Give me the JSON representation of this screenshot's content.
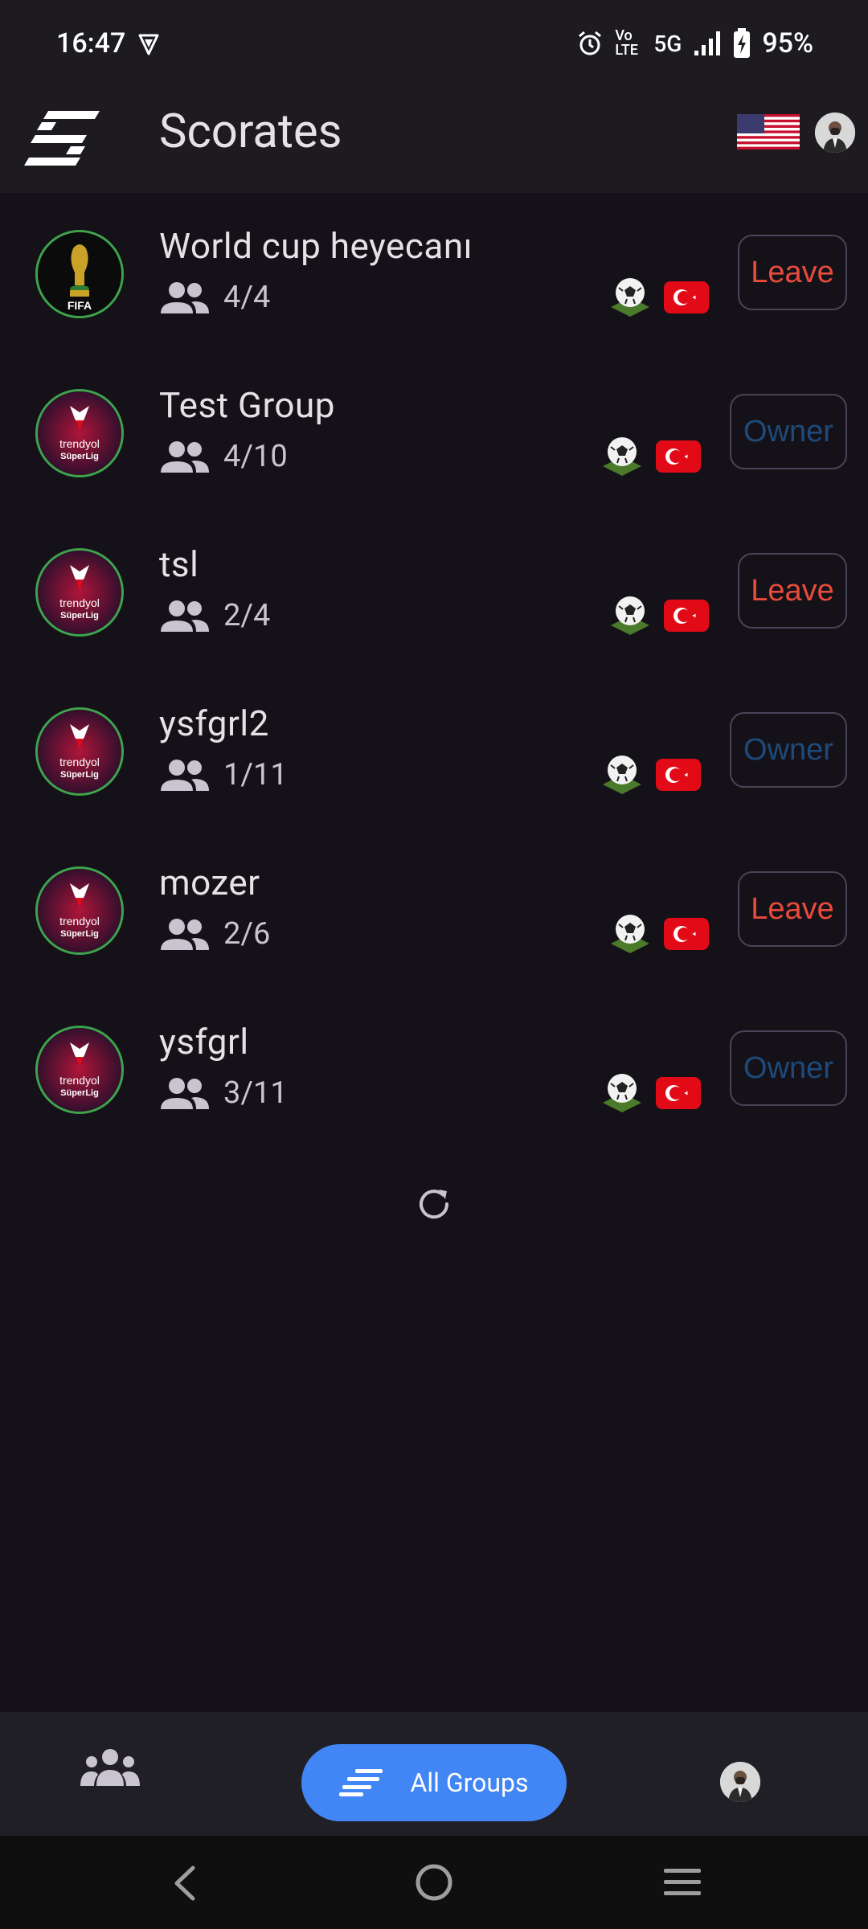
{
  "status_bar": {
    "time": "16:47",
    "battery": "95%",
    "network": "5G",
    "volte": "Vo LTE"
  },
  "app_bar": {
    "title": "Scorates",
    "language_flag": "us-flag"
  },
  "groups": [
    {
      "name": "World cup heyecanı",
      "members": "4/4",
      "badge": "fifa-world-cup",
      "action": "Leave",
      "action_type": "leave"
    },
    {
      "name": "Test Group",
      "members": "4/10",
      "badge": "trendyol-superlig",
      "action": "Owner",
      "action_type": "owner"
    },
    {
      "name": "tsl",
      "members": "2/4",
      "badge": "trendyol-superlig",
      "action": "Leave",
      "action_type": "leave"
    },
    {
      "name": "ysfgrl2",
      "members": "1/11",
      "badge": "trendyol-superlig",
      "action": "Owner",
      "action_type": "owner"
    },
    {
      "name": "mozer",
      "members": "2/6",
      "badge": "trendyol-superlig",
      "action": "Leave",
      "action_type": "leave"
    },
    {
      "name": "ysfgrl",
      "members": "3/11",
      "badge": "trendyol-superlig",
      "action": "Owner",
      "action_type": "owner"
    }
  ],
  "bottom_nav": {
    "active_label": "All Groups"
  },
  "colors": {
    "leave": "#e84b3c",
    "owner": "#1d4a7a",
    "pill": "#4285f4",
    "badge_ring": "#3fa34d"
  }
}
